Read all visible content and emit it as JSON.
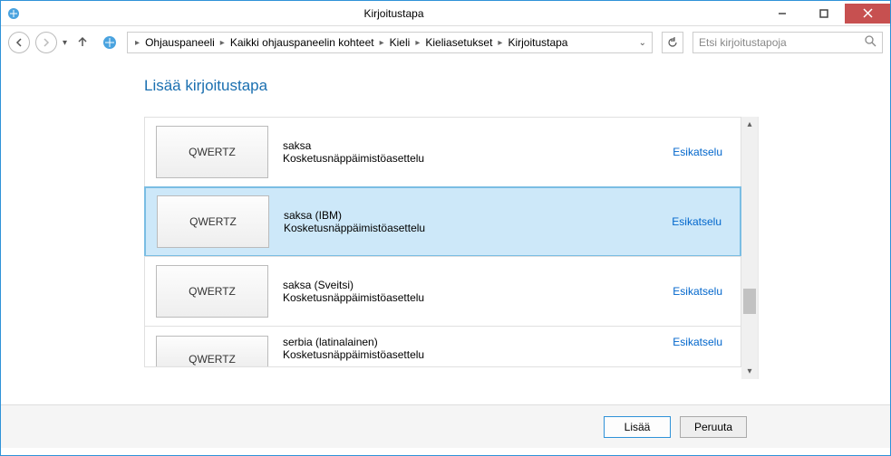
{
  "window": {
    "title": "Kirjoitustapa"
  },
  "breadcrumb": {
    "items": [
      "Ohjauspaneeli",
      "Kaikki ohjauspaneelin kohteet",
      "Kieli",
      "Kieliasetukset",
      "Kirjoitustapa"
    ]
  },
  "search": {
    "placeholder": "Etsi kirjoitustapoja"
  },
  "page": {
    "heading": "Lisää kirjoitustapa"
  },
  "items": [
    {
      "tile": "QWERTZ",
      "name": "saksa",
      "sub": "Kosketusnäppäimistöasettelu",
      "preview": "Esikatselu",
      "selected": false
    },
    {
      "tile": "QWERTZ",
      "name": "saksa (IBM)",
      "sub": "Kosketusnäppäimistöasettelu",
      "preview": "Esikatselu",
      "selected": true
    },
    {
      "tile": "QWERTZ",
      "name": "saksa (Sveitsi)",
      "sub": "Kosketusnäppäimistöasettelu",
      "preview": "Esikatselu",
      "selected": false
    },
    {
      "tile": "QWERTZ",
      "name": "serbia (latinalainen)",
      "sub": "Kosketusnäppäimistöasettelu",
      "preview": "Esikatselu",
      "selected": false
    }
  ],
  "buttons": {
    "add": "Lisää",
    "cancel": "Peruuta"
  }
}
